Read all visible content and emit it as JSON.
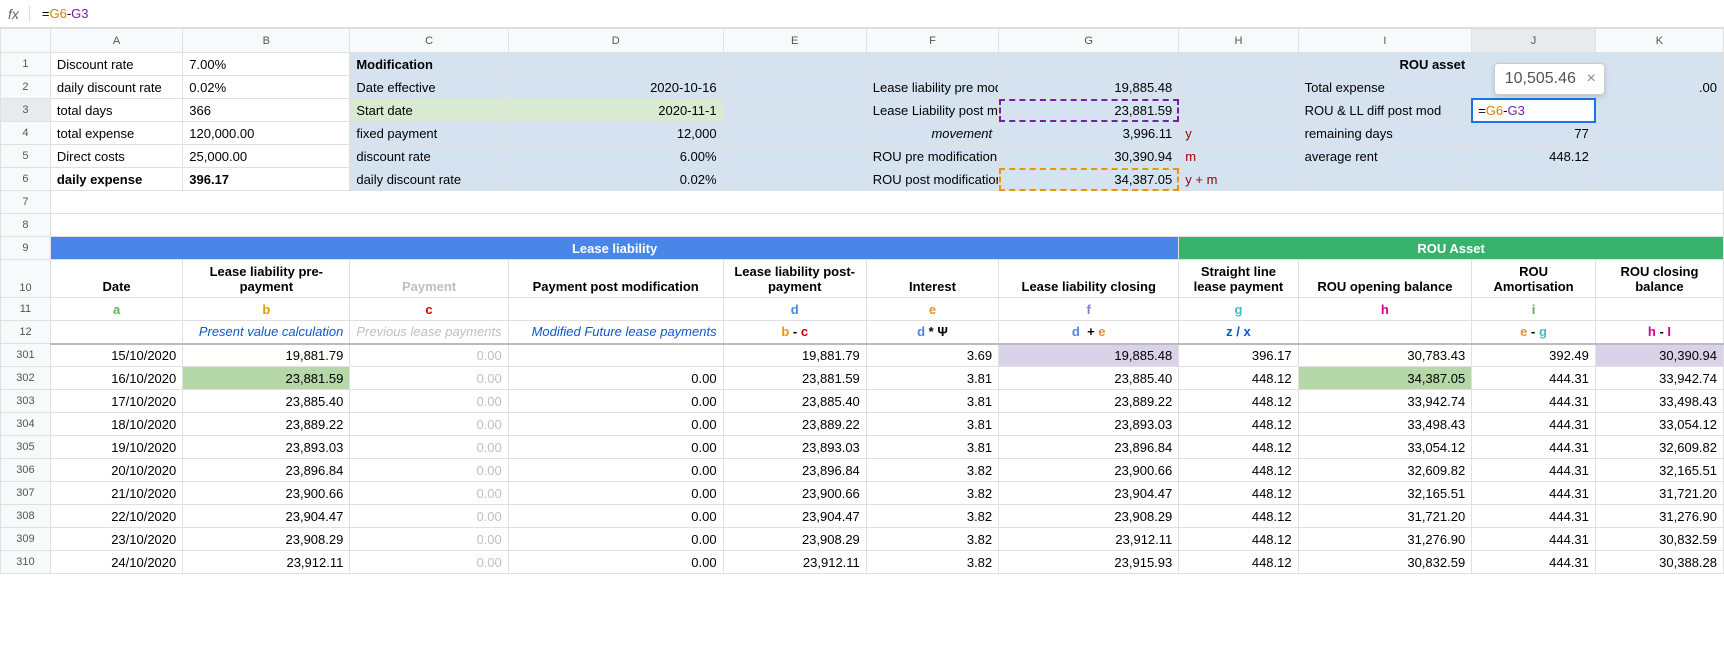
{
  "formula_bar": {
    "fx": "fx",
    "eq": "=",
    "ref1": "G6",
    "op": "-",
    "ref2": "G3"
  },
  "tooltip": {
    "value": "10,505.46",
    "close": "×"
  },
  "cell_input": "=G6-G3",
  "cols": [
    "A",
    "B",
    "C",
    "D",
    "E",
    "F",
    "G",
    "H",
    "I",
    "J",
    "K"
  ],
  "top": {
    "r1": {
      "A": "Discount rate",
      "B": "7.00%",
      "C": "Modification",
      "I": "ROU asset"
    },
    "r2": {
      "A": "daily discount rate",
      "B": "0.02%",
      "C": "Date effective",
      "D": "2020-10-16",
      "F": "Lease liability pre modification",
      "G": "19,885.48",
      "I": "Total expense",
      "K": ".00"
    },
    "r3": {
      "A": "total days",
      "B": "366",
      "C": "Start date",
      "D": "2020-11-1",
      "F": "Lease Liability post modification",
      "G": "23,881.59",
      "I": "ROU & LL diff post mod"
    },
    "r4": {
      "A": "total expense",
      "B": "120,000.00",
      "C": "fixed payment",
      "D": "12,000",
      "F": "movement",
      "G": "3,996.11",
      "H": "y",
      "I": "remaining days",
      "J": "77"
    },
    "r5": {
      "A": "Direct costs",
      "B": "25,000.00",
      "C": "discount rate",
      "D": "6.00%",
      "F": "ROU pre modification",
      "G": "30,390.94",
      "H": "m",
      "I": "average rent",
      "J": "448.12"
    },
    "r6": {
      "A": "daily expense",
      "B": "396.17",
      "C": "daily discount rate",
      "D": "0.02%",
      "F": "ROU post modification",
      "G": "34,387.05",
      "H": "y + m"
    }
  },
  "section_headers": {
    "ll": "Lease liability",
    "rou": "ROU Asset"
  },
  "col_headers": {
    "A": "Date",
    "B": "Lease liability pre-payment",
    "C": "Payment",
    "D": "Payment post modification",
    "E": "Lease liability post-payment",
    "F": "Interest",
    "G": "Lease liability closing",
    "H": "Straight line lease payment",
    "I": "ROU opening balance",
    "J": "ROU Amortisation",
    "K": "ROU closing balance"
  },
  "letters": {
    "A": "a",
    "B": "b",
    "C": "c",
    "D": "",
    "E": "d",
    "F": "e",
    "G": "f",
    "H": "g",
    "I": "h",
    "J": "i",
    "K": ""
  },
  "formulas": {
    "B": "Present value calculation",
    "C": "Previous lease payments",
    "D": "Modified Future lease payments",
    "E": "b - c",
    "F": "d * Ψ",
    "G": "d  + e",
    "H": "z / x",
    "J": "e - g",
    "K": "h - I"
  },
  "rows": [
    {
      "n": "301",
      "A": "15/10/2020",
      "B": "19,881.79",
      "C": "0.00",
      "D": "",
      "E": "19,881.79",
      "F": "3.69",
      "G": "19,885.48",
      "H": "396.17",
      "I": "30,783.43",
      "J": "392.49",
      "K": "30,390.94"
    },
    {
      "n": "302",
      "A": "16/10/2020",
      "B": "23,881.59",
      "C": "0.00",
      "D": "0.00",
      "E": "23,881.59",
      "F": "3.81",
      "G": "23,885.40",
      "H": "448.12",
      "I": "34,387.05",
      "J": "444.31",
      "K": "33,942.74"
    },
    {
      "n": "303",
      "A": "17/10/2020",
      "B": "23,885.40",
      "C": "0.00",
      "D": "0.00",
      "E": "23,885.40",
      "F": "3.81",
      "G": "23,889.22",
      "H": "448.12",
      "I": "33,942.74",
      "J": "444.31",
      "K": "33,498.43"
    },
    {
      "n": "304",
      "A": "18/10/2020",
      "B": "23,889.22",
      "C": "0.00",
      "D": "0.00",
      "E": "23,889.22",
      "F": "3.81",
      "G": "23,893.03",
      "H": "448.12",
      "I": "33,498.43",
      "J": "444.31",
      "K": "33,054.12"
    },
    {
      "n": "305",
      "A": "19/10/2020",
      "B": "23,893.03",
      "C": "0.00",
      "D": "0.00",
      "E": "23,893.03",
      "F": "3.81",
      "G": "23,896.84",
      "H": "448.12",
      "I": "33,054.12",
      "J": "444.31",
      "K": "32,609.82"
    },
    {
      "n": "306",
      "A": "20/10/2020",
      "B": "23,896.84",
      "C": "0.00",
      "D": "0.00",
      "E": "23,896.84",
      "F": "3.82",
      "G": "23,900.66",
      "H": "448.12",
      "I": "32,609.82",
      "J": "444.31",
      "K": "32,165.51"
    },
    {
      "n": "307",
      "A": "21/10/2020",
      "B": "23,900.66",
      "C": "0.00",
      "D": "0.00",
      "E": "23,900.66",
      "F": "3.82",
      "G": "23,904.47",
      "H": "448.12",
      "I": "32,165.51",
      "J": "444.31",
      "K": "31,721.20"
    },
    {
      "n": "308",
      "A": "22/10/2020",
      "B": "23,904.47",
      "C": "0.00",
      "D": "0.00",
      "E": "23,904.47",
      "F": "3.82",
      "G": "23,908.29",
      "H": "448.12",
      "I": "31,721.20",
      "J": "444.31",
      "K": "31,276.90"
    },
    {
      "n": "309",
      "A": "23/10/2020",
      "B": "23,908.29",
      "C": "0.00",
      "D": "0.00",
      "E": "23,908.29",
      "F": "3.82",
      "G": "23,912.11",
      "H": "448.12",
      "I": "31,276.90",
      "J": "444.31",
      "K": "30,832.59"
    },
    {
      "n": "310",
      "A": "24/10/2020",
      "B": "23,912.11",
      "C": "0.00",
      "D": "0.00",
      "E": "23,912.11",
      "F": "3.82",
      "G": "23,915.93",
      "H": "448.12",
      "I": "30,832.59",
      "J": "444.31",
      "K": "30,388.28"
    }
  ]
}
